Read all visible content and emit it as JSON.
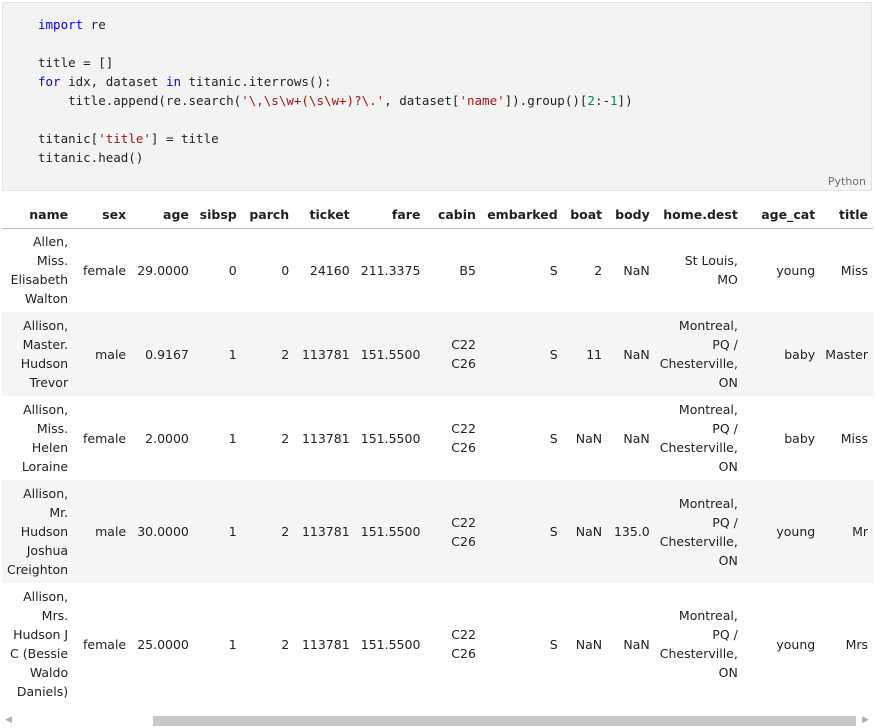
{
  "code_cell": {
    "lines": [
      [
        {
          "t": "import",
          "c": "kw"
        },
        {
          "t": " re"
        }
      ],
      [],
      [
        {
          "t": "title = []"
        }
      ],
      [
        {
          "t": "for",
          "c": "kw"
        },
        {
          "t": " idx, dataset "
        },
        {
          "t": "in",
          "c": "kw"
        },
        {
          "t": " titanic.iterrows():"
        }
      ],
      [
        {
          "t": "    title.append(re.search("
        },
        {
          "t": "'\\,\\s\\w+(\\s\\w+)?\\.'",
          "c": "str"
        },
        {
          "t": ", dataset["
        },
        {
          "t": "'name'",
          "c": "str"
        },
        {
          "t": "]).group()["
        },
        {
          "t": "2",
          "c": "num"
        },
        {
          "t": ":-"
        },
        {
          "t": "1",
          "c": "num"
        },
        {
          "t": "])"
        }
      ],
      [],
      [
        {
          "t": "titanic["
        },
        {
          "t": "'title'",
          "c": "str"
        },
        {
          "t": "] = title"
        }
      ],
      [
        {
          "t": "titanic.head()"
        }
      ]
    ],
    "language": "Python"
  },
  "table": {
    "columns": [
      {
        "key": "name",
        "label": "name"
      },
      {
        "key": "sex",
        "label": "sex"
      },
      {
        "key": "age",
        "label": "age"
      },
      {
        "key": "sibsp",
        "label": "sibsp"
      },
      {
        "key": "parch",
        "label": "parch"
      },
      {
        "key": "ticket",
        "label": "ticket"
      },
      {
        "key": "fare",
        "label": "fare"
      },
      {
        "key": "cabin",
        "label": "cabin"
      },
      {
        "key": "embarked",
        "label": "embarked"
      },
      {
        "key": "boat",
        "label": "boat"
      },
      {
        "key": "body",
        "label": "body"
      },
      {
        "key": "home_dest",
        "label": "home.dest"
      },
      {
        "key": "age_cat",
        "label": "age_cat"
      },
      {
        "key": "title",
        "label": "title"
      }
    ],
    "rows": [
      {
        "name": [
          "Allen,",
          "Miss.",
          "Elisabeth",
          "Walton"
        ],
        "sex": "female",
        "age": "29.0000",
        "sibsp": "0",
        "parch": "0",
        "ticket": "24160",
        "fare": "211.3375",
        "cabin": [
          "B5"
        ],
        "embarked": "S",
        "boat": "2",
        "body": "NaN",
        "home_dest": [
          "St Louis,",
          "MO"
        ],
        "age_cat": "young",
        "title": "Miss"
      },
      {
        "name": [
          "Allison,",
          "Master.",
          "Hudson",
          "Trevor"
        ],
        "sex": "male",
        "age": "0.9167",
        "sibsp": "1",
        "parch": "2",
        "ticket": "113781",
        "fare": "151.5500",
        "cabin": [
          "C22",
          "C26"
        ],
        "embarked": "S",
        "boat": "11",
        "body": "NaN",
        "home_dest": [
          "Montreal,",
          "PQ /",
          "Chesterville,",
          "ON"
        ],
        "age_cat": "baby",
        "title": "Master"
      },
      {
        "name": [
          "Allison,",
          "Miss.",
          "Helen",
          "Loraine"
        ],
        "sex": "female",
        "age": "2.0000",
        "sibsp": "1",
        "parch": "2",
        "ticket": "113781",
        "fare": "151.5500",
        "cabin": [
          "C22",
          "C26"
        ],
        "embarked": "S",
        "boat": "NaN",
        "body": "NaN",
        "home_dest": [
          "Montreal,",
          "PQ /",
          "Chesterville,",
          "ON"
        ],
        "age_cat": "baby",
        "title": "Miss"
      },
      {
        "name": [
          "Allison,",
          "Mr.",
          "Hudson",
          "Joshua",
          "Creighton"
        ],
        "sex": "male",
        "age": "30.0000",
        "sibsp": "1",
        "parch": "2",
        "ticket": "113781",
        "fare": "151.5500",
        "cabin": [
          "C22",
          "C26"
        ],
        "embarked": "S",
        "boat": "NaN",
        "body": "135.0",
        "home_dest": [
          "Montreal,",
          "PQ /",
          "Chesterville,",
          "ON"
        ],
        "age_cat": "young",
        "title": "Mr"
      },
      {
        "name": [
          "Allison,",
          "Mrs.",
          "Hudson J",
          "C (Bessie",
          "Waldo",
          "Daniels)"
        ],
        "sex": "female",
        "age": "25.0000",
        "sibsp": "1",
        "parch": "2",
        "ticket": "113781",
        "fare": "151.5500",
        "cabin": [
          "C22",
          "C26"
        ],
        "embarked": "S",
        "boat": "NaN",
        "body": "NaN",
        "home_dest": [
          "Montreal,",
          "PQ /",
          "Chesterville,",
          "ON"
        ],
        "age_cat": "young",
        "title": "Mrs"
      }
    ]
  },
  "scrollbar": {
    "left_arrow": "◀",
    "right_arrow": "▶",
    "thumb_start_fraction": 0.17,
    "thumb_visible_fraction": 0.81
  }
}
